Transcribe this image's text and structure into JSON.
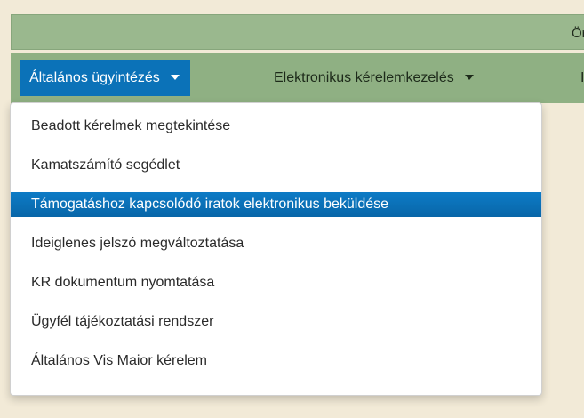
{
  "top_bar": {
    "partial_text": "Ör"
  },
  "nav": {
    "items": [
      {
        "label": "Általános ügyintézés",
        "active": true
      },
      {
        "label": "Elektronikus kérelemkezelés",
        "active": false
      },
      {
        "label": "I",
        "active": false
      }
    ]
  },
  "dropdown": {
    "items": [
      {
        "label": "Beadott kérelmek megtekintése"
      },
      {
        "label": "Kamatszámító segédlet"
      },
      {
        "label": "Támogatáshoz kapcsolódó iratok elektronikus beküldése",
        "highlighted": true
      },
      {
        "label": "Ideiglenes jelszó megváltoztatása"
      },
      {
        "label": "KR dokumentum nyomtatása"
      },
      {
        "label": "Ügyfél tájékoztatási rendszer"
      },
      {
        "label": "Általános Vis Maior kérelem"
      }
    ]
  },
  "colors": {
    "background": "#f2ead7",
    "top_bar": "#9ab88e",
    "nav_bar": "#8fb083",
    "active_blue": "#0b72b8"
  }
}
